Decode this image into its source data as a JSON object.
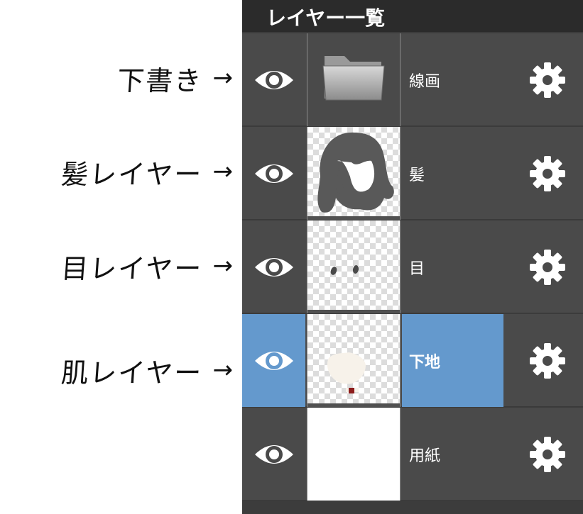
{
  "annotations": [
    {
      "text": "下書き",
      "arrow": "→"
    },
    {
      "text": "髪レイヤー",
      "arrow": "→"
    },
    {
      "text": "目レイヤー",
      "arrow": "→"
    },
    {
      "text": "肌レイヤー",
      "arrow": "→"
    }
  ],
  "panel": {
    "title": "レイヤー一覧",
    "layers": [
      {
        "name": "線画",
        "thumbnail": "folder-icon",
        "visible": true,
        "selected": false
      },
      {
        "name": "髪",
        "thumbnail": "hair-drawing",
        "visible": true,
        "selected": false
      },
      {
        "name": "目",
        "thumbnail": "eyes-drawing",
        "visible": true,
        "selected": false
      },
      {
        "name": "下地",
        "thumbnail": "skin-drawing",
        "visible": true,
        "selected": true
      },
      {
        "name": "用紙",
        "thumbnail": "white-paper",
        "visible": true,
        "selected": false
      }
    ]
  },
  "colors": {
    "panel_bg": "#3c3c3c",
    "header_bg": "#2b2b2b",
    "row_bg": "#4a4a4a",
    "selected": "#6499cd",
    "text": "#ffffff"
  }
}
